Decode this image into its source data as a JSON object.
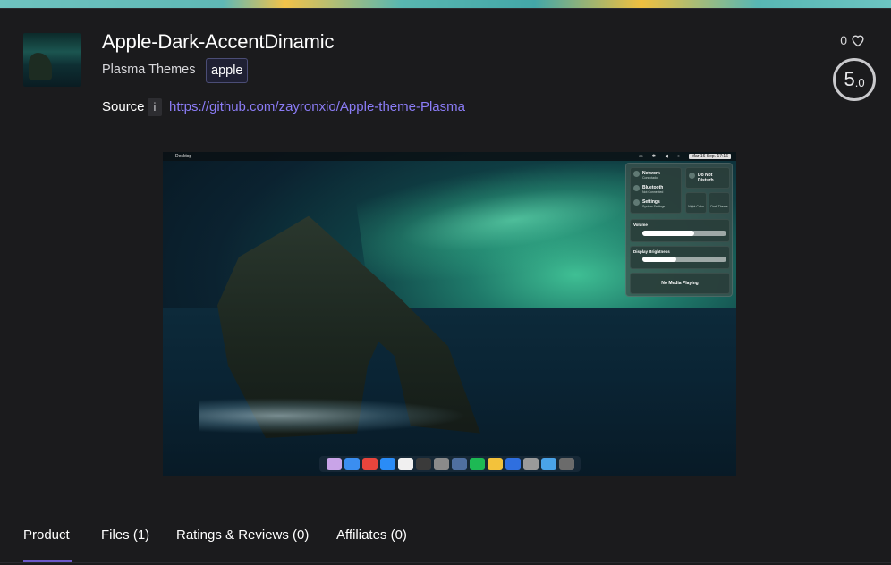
{
  "colors": {
    "accent": "#8b7cf6",
    "tab_underline": "#6c59c9",
    "background": "#1b1b1d"
  },
  "product": {
    "title": "Apple-Dark-AccentDinamic",
    "category": "Plasma Themes",
    "tag": "apple",
    "source_label": "Source",
    "info_label": "i",
    "source_url": "https://github.com/zayronxio/Apple-theme-Plasma",
    "likes": "0",
    "rating_major": "5",
    "rating_minor": ".0"
  },
  "screenshot": {
    "menubar_left": "Desktop",
    "menubar_clock": "Mar 16 Sep. 17:16",
    "cc": {
      "network": "Network",
      "network_sub": "Conectado",
      "bluetooth": "Bluetooth",
      "bluetooth_sub": "Not Connected",
      "settings": "Settings",
      "settings_sub": "System Settings",
      "dnd": "Do Not Disturb",
      "night": "Night Color",
      "dark": "Dark Theme",
      "volume": "Volume",
      "brightness": "Display Brightness",
      "media": "No Media Playing"
    }
  },
  "tabs": [
    {
      "label": "Product"
    },
    {
      "label": "Files (1)"
    },
    {
      "label": "Ratings & Reviews (0)"
    },
    {
      "label": "Affiliates (0)"
    }
  ]
}
